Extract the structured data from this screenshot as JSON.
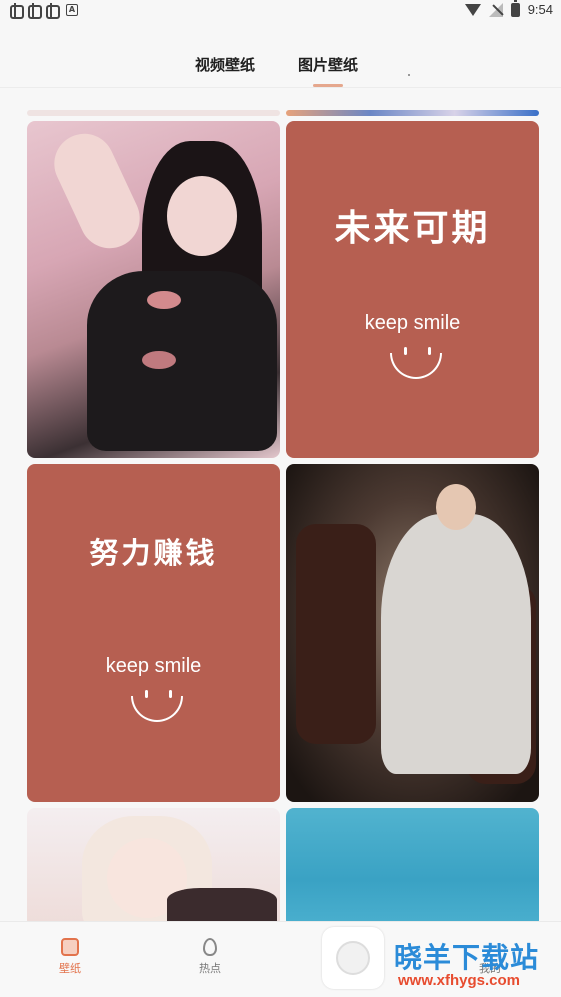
{
  "status_bar": {
    "time": "9:54",
    "badge": "A"
  },
  "tabs": [
    {
      "label": "视频壁纸",
      "active": false
    },
    {
      "label": "图片壁纸",
      "active": true
    }
  ],
  "colors": {
    "accent": "#e2734c",
    "tab_underline": "#e5a78d",
    "quote_card": "#b65f51"
  },
  "cards": {
    "quote1": {
      "title": "未来可期",
      "subtitle": "keep smile"
    },
    "quote2": {
      "title": "努力赚钱",
      "subtitle": "keep smile"
    }
  },
  "bottom_nav": [
    {
      "label": "壁纸",
      "icon": "wallpaper-icon",
      "active": true
    },
    {
      "label": "热点",
      "icon": "fire-icon",
      "active": false
    },
    {
      "label": "我的",
      "icon": "user-icon",
      "active": false
    }
  ],
  "watermark": {
    "brand": "晓羊下载站",
    "url": "www.xfhygs.com"
  }
}
